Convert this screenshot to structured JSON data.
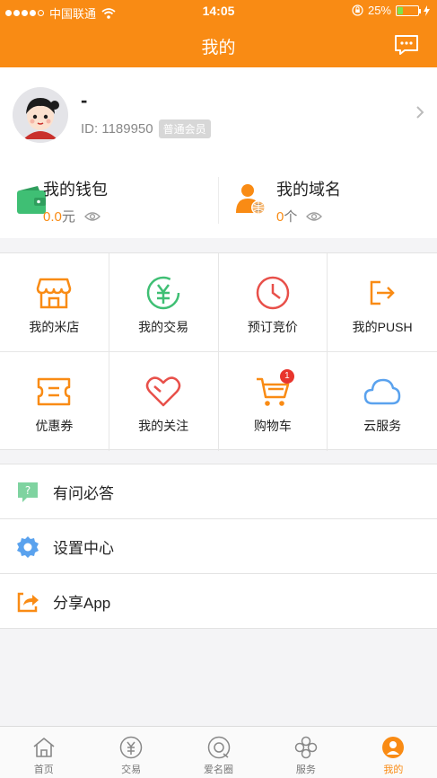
{
  "status_bar": {
    "carrier": "中国联通",
    "time": "14:05",
    "battery": "25%",
    "battery_level": 0.25
  },
  "nav": {
    "title": "我的",
    "message_icon": "message-icon"
  },
  "profile": {
    "name": "-",
    "id_text": "ID: 1189950",
    "member_badge": "普通会员"
  },
  "stats": {
    "wallet": {
      "label": "我的钱包",
      "value": "0.0",
      "unit": "元"
    },
    "domains": {
      "label": "我的域名",
      "value": "0",
      "unit": "个"
    }
  },
  "grid": [
    {
      "label": "我的米店",
      "icon": "shop-icon"
    },
    {
      "label": "我的交易",
      "icon": "trade-icon"
    },
    {
      "label": "预订竞价",
      "icon": "clock-icon"
    },
    {
      "label": "我的PUSH",
      "icon": "push-icon"
    },
    {
      "label": "优惠券",
      "icon": "coupon-icon"
    },
    {
      "label": "我的关注",
      "icon": "heart-icon"
    },
    {
      "label": "购物车",
      "icon": "cart-icon",
      "badge": "1"
    },
    {
      "label": "云服务",
      "icon": "cloud-icon"
    }
  ],
  "list": [
    {
      "label": "有问必答",
      "icon": "question-icon"
    },
    {
      "label": "设置中心",
      "icon": "settings-icon"
    },
    {
      "label": "分享App",
      "icon": "share-icon"
    }
  ],
  "tabs": [
    {
      "label": "首页",
      "icon": "home-icon"
    },
    {
      "label": "交易",
      "icon": "yuan-icon"
    },
    {
      "label": "爱名圈",
      "icon": "circle-icon"
    },
    {
      "label": "服务",
      "icon": "service-icon"
    },
    {
      "label": "我的",
      "icon": "profile-icon",
      "active": true
    }
  ],
  "colors": {
    "accent": "#f98b14",
    "wallet_green": "#3fbf74",
    "badge_red": "#e8352d",
    "cloud_blue": "#5aa2ee"
  }
}
